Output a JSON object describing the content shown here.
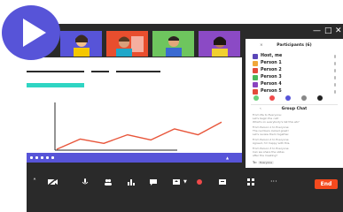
{
  "colors": {
    "accent": "#5754d8",
    "toolbar_bg": "#2a2a2a",
    "end_button": "#f44a1e",
    "chart_line": "#e8553a",
    "teal_bar": "#2fd5c3"
  },
  "participants_panel": {
    "title": "Participants (6)",
    "close_icon": "close-icon",
    "participants": [
      {
        "name": "Host, me",
        "avatar_color": "#5a46b8"
      },
      {
        "name": "Person 1",
        "avatar_color": "#f0a83a"
      },
      {
        "name": "Person 2",
        "avatar_color": "#e34a3a"
      },
      {
        "name": "Person 3",
        "avatar_color": "#4ab85a"
      },
      {
        "name": "Person 4",
        "avatar_color": "#8a44c0"
      },
      {
        "name": "Person 5",
        "avatar_color": "#e34a3a"
      }
    ],
    "reactions": [
      "#6ad07a",
      "#f04a4a",
      "#5754d8",
      "#888888",
      "#222222"
    ]
  },
  "group_chat": {
    "title": "Group Chat",
    "messages": [
      {
        "from": "From Me to Everyone:",
        "text": "Let's begin the call!",
        "extra": "What's on everybody's list this wk?"
      },
      {
        "from": "From Person 1 to Everyone:",
        "text": "The numbers looked great!",
        "extra": "Let's review them together."
      },
      {
        "from": "From Person 2 to Everyone:",
        "text": "Agreed, I'm happy with this.",
        "extra": ""
      },
      {
        "from": "From Person 3 to Everyone:",
        "text": "Can we share the slides",
        "extra": "after the meeting?"
      }
    ],
    "to_label": "To:",
    "to_value": "Everyone"
  },
  "toolbar": {
    "end_label": "End",
    "more_label": "···"
  },
  "shared_screen": {
    "chart_data": {
      "type": "line",
      "series": [
        {
          "values": [
            0,
            12,
            7,
            17,
            11,
            24,
            17,
            32
          ]
        }
      ],
      "ylim": [
        0,
        55
      ]
    }
  }
}
